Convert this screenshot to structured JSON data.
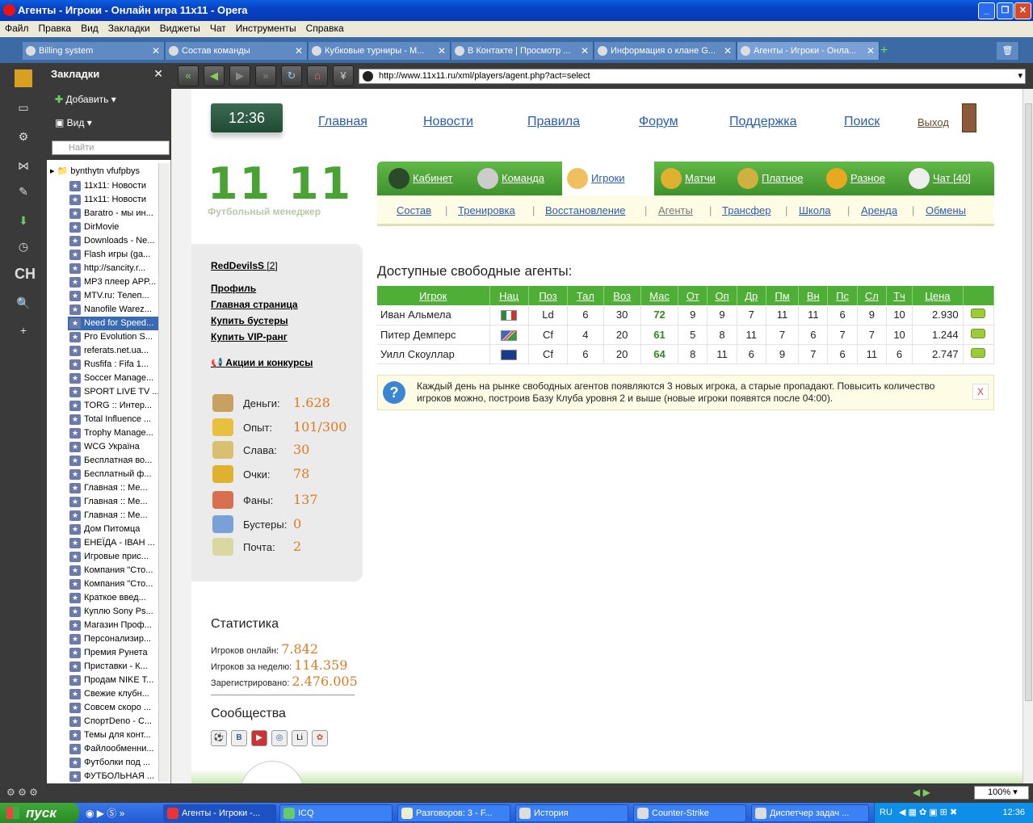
{
  "window": {
    "title": "Агенты - Игроки - Онлайн игра 11x11 - Opera"
  },
  "menu": [
    "Файл",
    "Правка",
    "Вид",
    "Закладки",
    "Виджеты",
    "Чат",
    "Инструменты",
    "Справка"
  ],
  "tabs": [
    {
      "label": "Billing system"
    },
    {
      "label": "Состав команды"
    },
    {
      "label": "Кубковые турниры - М..."
    },
    {
      "label": "В Контакте | Просмотр ..."
    },
    {
      "label": "Информация о клане G..."
    },
    {
      "label": "Агенты - Игроки - Онла..."
    }
  ],
  "bookmarks": {
    "title": "Закладки",
    "add_label": "Добавить",
    "view_label": "Вид",
    "search_placeholder": "Найти",
    "root": "bynthytn vfufpbys",
    "items": [
      "11x11: Новости",
      "11x11: Новости",
      "Baratro - мы ин...",
      "DirMovie",
      "Downloads - Ne...",
      "Flash игры (ga...",
      "http://sancity.r...",
      "MP3 плеер APP...",
      "MTV.ru: Телеп...",
      "Nanofile Warez...",
      "Need for Speed...",
      "Pro Evolution S...",
      "referats.net.ua...",
      "Rusfifa : Fifa 1...",
      "Soccer Manage...",
      "SPORT LIVE TV ...",
      "TORG :: Интер...",
      "Total Influence ...",
      "Trophy Manage...",
      "WCG Україна",
      "Бесплатная во...",
      "Бесплатный ф...",
      "Главная :: Ме...",
      "Главная :: Ме...",
      "Главная :: Ме...",
      "Дом Питомца",
      "ЕНЕЇДА - ІВАН ...",
      "Игровые прис...",
      "Компания \"Сто...",
      "Компания \"Сто...",
      "Краткое введ...",
      "Куплю Sony Ps...",
      "Магазин Проф...",
      "Персонализир...",
      "Премия Рунета",
      "Приставки - К...",
      "Продам NIKE T...",
      "Свежие клубн...",
      "Совсем скоро ...",
      "СпортDeno - С...",
      "Темы для конт...",
      "Файлообменни...",
      "Футболки под ...",
      "ФУТБОЛЬНАЯ ..."
    ],
    "selected_index": 10
  },
  "address": {
    "url": "http://www.11x11.ru/xml/players/agent.php?act=select"
  },
  "site": {
    "clock": "12:36",
    "nav": [
      "Главная",
      "Новости",
      "Правила",
      "Форум",
      "Поддержка",
      "Поиск"
    ],
    "logout": "Выход",
    "logo_main": "11 11",
    "logo_sub": "Футбольный менеджер",
    "main_tabs": [
      "Кабинет",
      "Команда",
      "Игроки",
      "Матчи",
      "Платное",
      "Разное",
      "Чат [40]"
    ],
    "active_tab": "Игроки",
    "sub_tabs": [
      "Состав",
      "Тренировка",
      "Восстановление",
      "Агенты",
      "Трансфер",
      "Школа",
      "Аренда",
      "Обмены"
    ]
  },
  "user": {
    "name": "RedDevilsS",
    "level": "[2]",
    "links": [
      "Профиль",
      "Главная страница",
      "Купить бустеры",
      "Купить VIP-ранг"
    ],
    "promo": "Акции и конкурсы",
    "stats": [
      {
        "label": "Деньги:",
        "value": "1.628"
      },
      {
        "label": "Опыт:",
        "value": "101/300"
      },
      {
        "label": "Слава:",
        "value": "30"
      },
      {
        "label": "Очки:",
        "value": "78"
      },
      {
        "label": "Фаны:",
        "value": "137"
      },
      {
        "label": "Бустеры:",
        "value": "0"
      },
      {
        "label": "Почта:",
        "value": "2"
      }
    ]
  },
  "statistics": {
    "title": "Статистика",
    "online_label": "Игроков онлайн:",
    "online_value": "7.842",
    "week_label": "Игроков за неделю:",
    "week_value": "114.359",
    "reg_label": "Зарегистрировано:",
    "reg_value": "2.476.005",
    "communities_title": "Сообщества",
    "community_icons": [
      "soccer-icon",
      "vkontakte-icon",
      "youtube-icon",
      "odnoklassniki-icon",
      "liveinternet-icon",
      "flickr-icon"
    ]
  },
  "agents": {
    "title": "Доступные свободные агенты:",
    "columns": [
      "Игрок",
      "Нац",
      "Поз",
      "Тал",
      "Воз",
      "Мас",
      "От",
      "Оп",
      "Др",
      "Пм",
      "Вн",
      "Пс",
      "Сл",
      "Тч",
      "Цена",
      ""
    ],
    "rows": [
      {
        "name": "Иван Альмела",
        "flag": "mexico-flag",
        "pos": "Ld",
        "tal": "6",
        "age": "30",
        "mas": "72",
        "ot": "9",
        "op": "9",
        "dr": "7",
        "pm": "11",
        "vn": "11",
        "ps": "6",
        "sl": "9",
        "tch": "10",
        "price": "2.930"
      },
      {
        "name": "Питер Демперс",
        "flag": "namibia-flag",
        "pos": "Cf",
        "tal": "4",
        "age": "20",
        "mas": "61",
        "ot": "5",
        "op": "8",
        "dr": "11",
        "pm": "7",
        "vn": "6",
        "ps": "7",
        "sl": "7",
        "tch": "10",
        "price": "1.244"
      },
      {
        "name": "Уилл Скоуллар",
        "flag": "australia-flag",
        "pos": "Cf",
        "tal": "6",
        "age": "20",
        "mas": "64",
        "ot": "8",
        "op": "11",
        "dr": "6",
        "pm": "9",
        "vn": "7",
        "ps": "6",
        "sl": "11",
        "tch": "6",
        "price": "2.747"
      }
    ],
    "info": "Каждый день на рынке свободных агентов появляются 3 новых игрока, а старые пропадают. Повысить количество игроков можно, построив Базу Клуба уровня 2 и выше (новые игроки появятся после 04:00).",
    "close": "X"
  },
  "statusbar": {
    "zoom": "100%"
  },
  "taskbar": {
    "start": "пуск",
    "tasks": [
      "Агенты - Игроки -...",
      "ICQ",
      "Разговоров: 3 - F...",
      "История",
      "Counter-Strike",
      "Диспетчер задач ..."
    ],
    "lang": "RU",
    "time": "12:36"
  }
}
